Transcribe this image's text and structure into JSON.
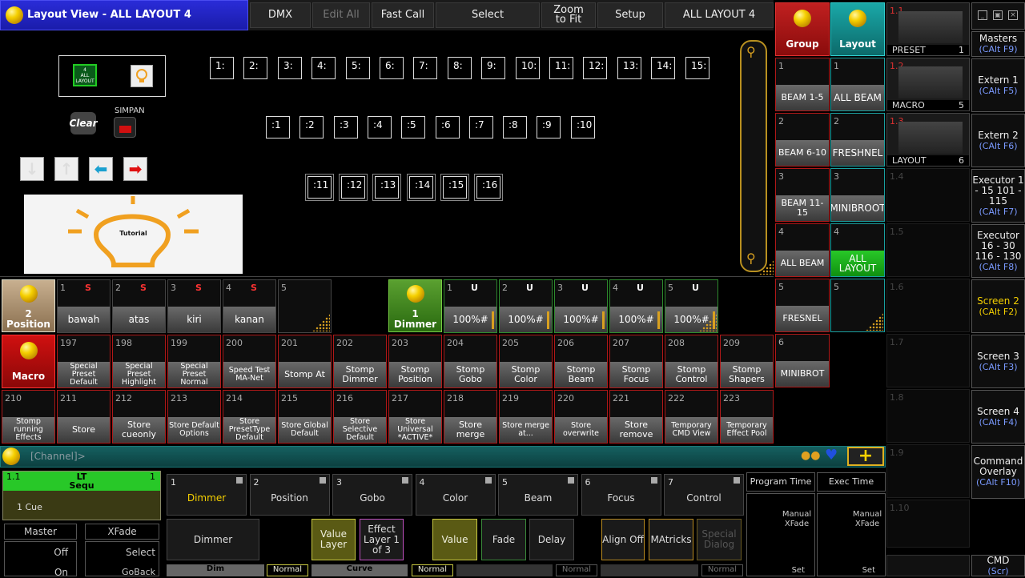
{
  "titlebar": {
    "title": "Layout View - ALL LAYOUT 4",
    "buttons": [
      "DMX",
      "Edit All",
      "Fast Call",
      "Select",
      "Zoom to Fit",
      "Setup",
      "ALL LAYOUT 4"
    ]
  },
  "canvas": {
    "layout_tile_label": "ALL LAYOUT",
    "layout_tile_num": "4",
    "clear_label": "Clear",
    "simpan_label": "SIMPAN",
    "tutorial_label": "Tutorial",
    "row1": [
      "1:",
      "2:",
      "3:",
      "4:",
      "5:",
      "6:",
      "7:",
      "8:",
      "9:",
      "10:",
      "11:",
      "12:",
      "13:",
      "14:",
      "15:"
    ],
    "row2": [
      ":1",
      ":2",
      ":3",
      ":4",
      ":5",
      ":6",
      ":7",
      ":8",
      ":9",
      ":10"
    ],
    "row3": [
      ":11",
      ":12",
      ":13",
      ":14",
      ":15",
      ":16"
    ]
  },
  "group_pool": {
    "header": "Group",
    "items": [
      {
        "n": "1",
        "label": "BEAM 1-5"
      },
      {
        "n": "2",
        "label": "BEAM 6-10"
      },
      {
        "n": "3",
        "label": "BEAM 11-15"
      },
      {
        "n": "4",
        "label": "ALL BEAM"
      },
      {
        "n": "5",
        "label": "FRESNEL"
      },
      {
        "n": "6",
        "label": "MINIBROT"
      }
    ]
  },
  "layout_pool": {
    "header": "Layout",
    "items": [
      {
        "n": "1",
        "label": "ALL BEAM"
      },
      {
        "n": "2",
        "label": "FRESHNEL"
      },
      {
        "n": "3",
        "label": "MINIBROOT"
      },
      {
        "n": "4",
        "label": "ALL LAYOUT"
      },
      {
        "n": "5",
        "label": ""
      }
    ]
  },
  "position_pool": {
    "header_num": "2",
    "header": "Position",
    "items": [
      {
        "n": "1",
        "flag": "S",
        "label": "bawah"
      },
      {
        "n": "2",
        "flag": "S",
        "label": "atas"
      },
      {
        "n": "3",
        "flag": "S",
        "label": "kiri"
      },
      {
        "n": "4",
        "flag": "S",
        "label": "kanan"
      },
      {
        "n": "5",
        "flag": "",
        "label": ""
      }
    ]
  },
  "dimmer_pool": {
    "header_num": "1",
    "header": "Dimmer",
    "items": [
      {
        "n": "1",
        "flag": "U",
        "label": "100%#"
      },
      {
        "n": "2",
        "flag": "U",
        "label": "100%#"
      },
      {
        "n": "3",
        "flag": "U",
        "label": "100%#"
      },
      {
        "n": "4",
        "flag": "U",
        "label": "100%#"
      },
      {
        "n": "5",
        "flag": "U",
        "label": "100%#"
      }
    ]
  },
  "macro_pool": {
    "header": "Macro",
    "row1": [
      {
        "n": "197",
        "label": "Special Preset Default"
      },
      {
        "n": "198",
        "label": "Special Preset Highlight"
      },
      {
        "n": "199",
        "label": "Special Preset Normal"
      },
      {
        "n": "200",
        "label": "Speed Test MA-Net"
      },
      {
        "n": "201",
        "label": "Stomp At"
      },
      {
        "n": "202",
        "label": "Stomp Dimmer"
      },
      {
        "n": "203",
        "label": "Stomp Position"
      },
      {
        "n": "204",
        "label": "Stomp Gobo"
      },
      {
        "n": "205",
        "label": "Stomp Color"
      },
      {
        "n": "206",
        "label": "Stomp Beam"
      },
      {
        "n": "207",
        "label": "Stomp Focus"
      },
      {
        "n": "208",
        "label": "Stomp Control"
      },
      {
        "n": "209",
        "label": "Stomp Shapers"
      }
    ],
    "row2": [
      {
        "n": "210",
        "label": "Stomp running Effects"
      },
      {
        "n": "211",
        "label": "Store"
      },
      {
        "n": "212",
        "label": "Store cueonly"
      },
      {
        "n": "213",
        "label": "Store Default Options"
      },
      {
        "n": "214",
        "label": "Store PresetType Default"
      },
      {
        "n": "215",
        "label": "Store Global Default"
      },
      {
        "n": "216",
        "label": "Store Selective Default"
      },
      {
        "n": "217",
        "label": "Store Universal *ACTIVE*"
      },
      {
        "n": "218",
        "label": "Store merge"
      },
      {
        "n": "219",
        "label": "Store merge at..."
      },
      {
        "n": "220",
        "label": "Store overwrite"
      },
      {
        "n": "221",
        "label": "Store remove"
      },
      {
        "n": "222",
        "label": "Temporary CMD View"
      },
      {
        "n": "223",
        "label": "Temporary Effect Pool"
      }
    ]
  },
  "viewer_column": [
    {
      "n": "1.1",
      "label": "PRESET",
      "num": "1"
    },
    {
      "n": "1.2",
      "label": "MACRO",
      "num": "5"
    },
    {
      "n": "1.3",
      "label": "LAYOUT",
      "num": "6"
    },
    {
      "n": "1.4"
    },
    {
      "n": "1.5"
    },
    {
      "n": "1.6"
    },
    {
      "n": "1.7"
    },
    {
      "n": "1.8"
    },
    {
      "n": "1.9"
    },
    {
      "n": "1.10"
    }
  ],
  "right_column": [
    {
      "label": "Masters",
      "key": "(CAlt F9)"
    },
    {
      "label": "Extern 1",
      "key": "(CAlt F5)"
    },
    {
      "label": "Extern 2",
      "key": "(CAlt F6)"
    },
    {
      "label": "Executor 1 - 15 101 - 115",
      "key": "(CAlt F7)"
    },
    {
      "label": "Executor 16 - 30 116 - 130",
      "key": "(CAlt F8)"
    },
    {
      "label": "Screen 2",
      "key": "(CAlt F2)"
    },
    {
      "label": "Screen 3",
      "key": "(CAlt F3)"
    },
    {
      "label": "Screen 4",
      "key": "(CAlt F4)"
    },
    {
      "label": "Command Overlay",
      "key": "(CAlt F10)"
    },
    {
      "label": "CMD",
      "key": "(Scr)"
    }
  ],
  "command_line": {
    "prompt": "[Channel]>"
  },
  "sequence": {
    "num": "1.1",
    "title": "LT Sequ",
    "count": "1",
    "cue": "1 Cue"
  },
  "master": {
    "label": "Master",
    "xfade": "XFade",
    "off": "Off",
    "on": "On",
    "select": "Select",
    "goback": "GoBack"
  },
  "presets": [
    {
      "n": "1",
      "label": "Dimmer"
    },
    {
      "n": "2",
      "label": "Position"
    },
    {
      "n": "3",
      "label": "Gobo"
    },
    {
      "n": "4",
      "label": "Color"
    },
    {
      "n": "5",
      "label": "Beam"
    },
    {
      "n": "6",
      "label": "Focus"
    },
    {
      "n": "7",
      "label": "Control"
    }
  ],
  "times": {
    "program": "Program Time",
    "exec": "Exec Time",
    "manual": "Manual XFade",
    "set": "Set"
  },
  "feature_bar": {
    "dimmer": "Dimmer",
    "value_layer": "Value Layer",
    "effect_layer": "Effect Layer 1 of 3",
    "value": "Value",
    "fade": "Fade",
    "delay": "Delay",
    "align": "Align Off",
    "matricks": "MAtricks",
    "special": "Special Dialog"
  },
  "footer": {
    "dim": "Dim",
    "normal": "Normal",
    "curve": "Curve"
  },
  "colors": {
    "accent": "#f5d000",
    "title_blue": "#2a2cd8",
    "macro_red": "#b01818",
    "cmd_teal": "#156060"
  }
}
